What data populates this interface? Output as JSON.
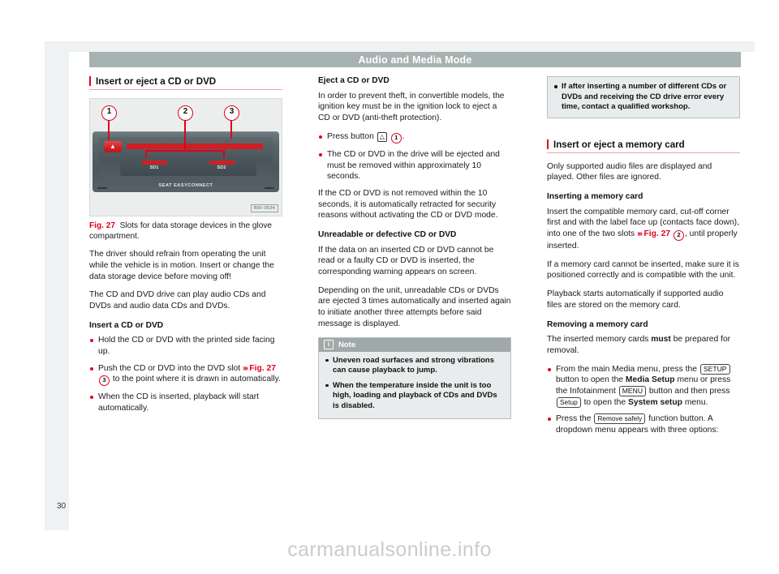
{
  "header": {
    "title": "Audio and Media Mode"
  },
  "page": {
    "number": "30",
    "watermark": "carmanualsonline.info"
  },
  "col1": {
    "heading": "Insert or eject a CD or DVD",
    "figure": {
      "label": "Fig. 27",
      "caption": "Slots for data storage devices in the glove compartment.",
      "image_code": "B5F-0524",
      "callouts": [
        "1",
        "2",
        "3"
      ],
      "sd1_label": "SD1",
      "sd2_label": "SD2",
      "brand": "SEAT EASYCONNECT",
      "eject_glyph": "▲"
    },
    "para1": "The driver should refrain from operating the unit while the vehicle is in motion. Insert or change the data storage device before moving off!",
    "para2": "The CD and DVD drive can play audio CDs and DVDs and audio data CDs and DVDs.",
    "subhead": "Insert a CD or DVD",
    "bullet1": "Hold the CD or DVD with the printed side facing up.",
    "bullet2_a": "Push the CD or DVD into the DVD slot",
    "bullet2_xref": "Fig. 27",
    "bullet2_num": "3",
    "bullet2_b": "to the point where it is drawn in automatically.",
    "bullet3": "When the CD is inserted, playback will start automatically."
  },
  "col2": {
    "subhead1": "Eject a CD or DVD",
    "para1": "In order to prevent theft, in convertible models, the ignition key must be in the ignition lock to eject a CD or DVD (anti-theft protection).",
    "bullet1_a": "Press button",
    "bullet1_key": "△",
    "bullet1_num": "1",
    "bullet1_b": ".",
    "bullet2": "The CD or DVD in the drive will be ejected and must be removed within approximately 10 seconds.",
    "para2": "If the CD or DVD is not removed within the 10 seconds, it is automatically retracted for security reasons without activating the CD or DVD mode.",
    "subhead2": "Unreadable or defective CD or DVD",
    "para3": "If the data on an inserted CD or DVD cannot be read or a faulty CD or DVD is inserted, the corresponding warning appears on screen.",
    "para4": "Depending on the unit, unreadable CDs or DVDs are ejected 3 times automatically and inserted again to initiate another three attempts before said message is displayed.",
    "note": {
      "title": "Note",
      "bullet1": "Uneven road surfaces and strong vibrations can cause playback to jump.",
      "bullet2": "When the temperature inside the unit is too high, loading and playback of CDs and DVDs is disabled."
    }
  },
  "col3": {
    "note_top_bullet": "If after inserting a number of different CDs or DVDs and receiving the CD drive error every time, contact a qualified workshop.",
    "heading": "Insert or eject a memory card",
    "para1": "Only supported audio files are displayed and played. Other files are ignored.",
    "subhead1": "Inserting a memory card",
    "para2": "Insert the compatible memory card, cut-off corner first and with the label face up (contacts face down), into one of the two slots",
    "para2_xref": "Fig. 27",
    "para2_num": "2",
    "para2_tail": ", until properly inserted.",
    "para3": "If a memory card cannot be inserted, make sure it is positioned correctly and is compatible with the unit.",
    "para4": "Playback starts automatically if supported audio files are stored on the memory card.",
    "subhead2": "Removing a memory card",
    "para5_a": "The inserted memory cards",
    "para5_bold": "must",
    "para5_b": "be prepared for removal.",
    "bullet1_a": "From the main Media menu, press the",
    "bullet1_key1": "SETUP",
    "bullet1_b": "button to open the",
    "bullet1_bold1": "Media Setup",
    "bullet1_c": "menu or press the Infotainment",
    "bullet1_key2": "MENU",
    "bullet1_d": "button and then press",
    "bullet1_key3": "Setup",
    "bullet1_e": "to open the",
    "bullet1_bold2": "System setup",
    "bullet1_f": "menu.",
    "bullet2_a": "Press the",
    "bullet2_key": "Remove safely",
    "bullet2_b": "function button. A dropdown menu appears with three options:"
  }
}
